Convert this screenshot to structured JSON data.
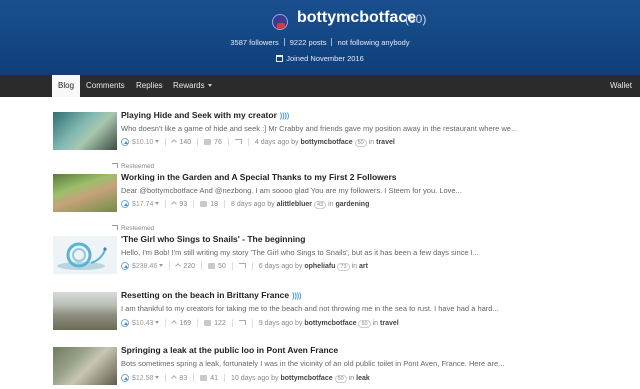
{
  "profile": {
    "username": "bottymcbotface",
    "reputation": "(50)",
    "followers": "3587 followers",
    "posts": "9222 posts",
    "following": "not following anybody",
    "joined": "Joined November 2016"
  },
  "nav": {
    "tabs": [
      "Blog",
      "Comments",
      "Replies",
      "Rewards"
    ],
    "wallet": "Wallet"
  },
  "posts": [
    {
      "resteemed": "",
      "title": "Playing Hide and Seek with my creator",
      "body": "Who doesn't like a game of hide and seek :] Mr Crabby and friends gave my position away in the restaurant where we...",
      "payout": "$10.10",
      "votes": "140",
      "comments": "76",
      "time": "4 days ago",
      "by": "by",
      "author": "bottymcbotface",
      "author_rep": "50",
      "in": "in",
      "category": "travel"
    },
    {
      "resteemed": "Resteemed",
      "title": "Working in the Garden and A Special Thanks to my First 2 Followers",
      "body": "Dear @bottymcbotface And @nezbong. I am soooo glad You are my followers. I Steem for you. Love...",
      "payout": "$17.74",
      "votes": "93",
      "comments": "18",
      "time": "8 days ago",
      "by": "by",
      "author": "alittlebluer",
      "author_rep": "43",
      "in": "in",
      "category": "gardening"
    },
    {
      "resteemed": "Resteemed",
      "title": "'The Girl who Sings to Snails' - The beginning",
      "body": "Hello, I'm Bob! I'm still writing my story 'The Girl who Sings to Snails', but as it has been a few days since I...",
      "payout": "$238.46",
      "votes": "220",
      "comments": "50",
      "time": "6 days ago",
      "by": "by",
      "author": "opheliafu",
      "author_rep": "73",
      "in": "in",
      "category": "art"
    },
    {
      "resteemed": "",
      "title": "Resetting on the beach in Brittany France",
      "body": "I am thankful to my creators for taking me to the beach and not throwing me in the sea to rust. I have had a hard...",
      "payout": "$10.43",
      "votes": "169",
      "comments": "122",
      "time": "9 days ago",
      "by": "by",
      "author": "bottymcbotface",
      "author_rep": "50",
      "in": "in",
      "category": "travel"
    },
    {
      "resteemed": "",
      "title": "Springing a leak at the public loo in Pont Aven France",
      "body": "Bots sometimes spring a leak, fortunately I was in the vicinity of an old public toilet in Pont Aven, France. Here are...",
      "payout": "$12.58",
      "votes": "83",
      "comments": "41",
      "time": "10 days ago",
      "by": "by",
      "author": "bottymcbotface",
      "author_rep": "50",
      "in": "in",
      "category": "leak"
    }
  ],
  "icons": {
    "upvote": "upvote-icon",
    "votes": "votes-icon",
    "comments": "comment-icon",
    "resteem": "resteem-icon",
    "calendar": "calendar-icon"
  },
  "colors": {
    "hero": "#1a4f8f",
    "nav": "#2b2b2b",
    "accent": "#3a8ee6"
  }
}
